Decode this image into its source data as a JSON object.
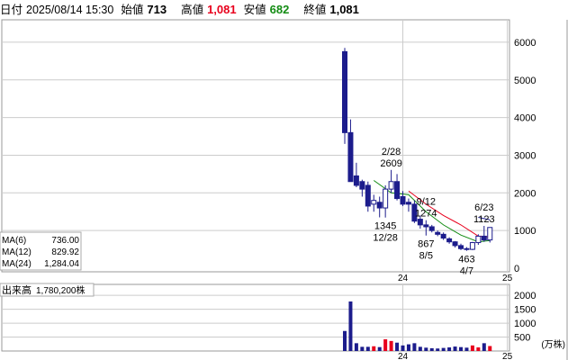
{
  "header": {
    "date_label": "日付",
    "date_value": "2025/08/14 15:30",
    "open_label": "始値",
    "open_value": "713",
    "high_label": "高値",
    "high_value": "1,081",
    "low_label": "安値",
    "low_value": "682",
    "close_label": "終値",
    "close_value": "1,081"
  },
  "legend": {
    "ma6_label": "MA(6)",
    "ma6_value": "736.00",
    "ma12_label": "MA(12)",
    "ma12_value": "829.92",
    "ma24_label": "MA(24)",
    "ma24_value": "1,284.04"
  },
  "volume": {
    "label": "出来高",
    "value": "1,780,200株",
    "unit": "(万株)"
  },
  "colors": {
    "candle_down": "#1c1c8c",
    "candle_up_border": "#1c1c8c",
    "ma6": "#138c13",
    "ma12": "#e8001c",
    "ma24": "#1c1c8c",
    "vol_up": "#e8001c",
    "vol_down": "#1c1c8c",
    "grid": "#cccccc"
  },
  "chart_data": {
    "type": "candlestick",
    "price_axis": {
      "ticks": [
        0,
        1000,
        2000,
        3000,
        4000,
        5000,
        6000
      ],
      "ylim": [
        0,
        6500
      ]
    },
    "volume_axis": {
      "ticks": [
        500,
        1000,
        1500,
        2000
      ],
      "ylim": [
        0,
        2200
      ]
    },
    "x_ticks": [
      {
        "label": "24",
        "index": 10
      },
      {
        "label": "25",
        "index": 28
      }
    ],
    "candles": [
      {
        "o": 5750,
        "h": 5850,
        "l": 3300,
        "c": 3600,
        "v": 720
      },
      {
        "o": 3600,
        "h": 3950,
        "l": 2300,
        "c": 2300,
        "v": 1780
      },
      {
        "o": 2450,
        "h": 2800,
        "l": 2150,
        "c": 2200,
        "v": 280
      },
      {
        "o": 2300,
        "h": 2350,
        "l": 1900,
        "c": 2100,
        "v": 150
      },
      {
        "o": 2200,
        "h": 2300,
        "l": 1500,
        "c": 1650,
        "v": 150
      },
      {
        "o": 1700,
        "h": 1950,
        "l": 1500,
        "c": 1800,
        "v": 170
      },
      {
        "o": 1750,
        "h": 1900,
        "l": 1350,
        "c": 1600,
        "v": 140
      },
      {
        "o": 1600,
        "h": 2200,
        "l": 1345,
        "c": 2100,
        "v": 420
      },
      {
        "o": 2100,
        "h": 2609,
        "l": 2000,
        "c": 2300,
        "v": 360
      },
      {
        "o": 2300,
        "h": 2500,
        "l": 1800,
        "c": 1850,
        "v": 300
      },
      {
        "o": 1900,
        "h": 2050,
        "l": 1650,
        "c": 1700,
        "v": 200
      },
      {
        "o": 1750,
        "h": 1850,
        "l": 1500,
        "c": 1700,
        "v": 240
      },
      {
        "o": 1700,
        "h": 1800,
        "l": 1200,
        "c": 1250,
        "v": 280
      },
      {
        "o": 1300,
        "h": 1400,
        "l": 1050,
        "c": 1150,
        "v": 150
      },
      {
        "o": 1150,
        "h": 1274,
        "l": 867,
        "c": 1100,
        "v": 120
      },
      {
        "o": 1100,
        "h": 1150,
        "l": 950,
        "c": 1000,
        "v": 100
      },
      {
        "o": 950,
        "h": 1000,
        "l": 850,
        "c": 900,
        "v": 90
      },
      {
        "o": 900,
        "h": 950,
        "l": 750,
        "c": 800,
        "v": 110
      },
      {
        "o": 780,
        "h": 820,
        "l": 650,
        "c": 700,
        "v": 130
      },
      {
        "o": 700,
        "h": 720,
        "l": 550,
        "c": 600,
        "v": 160
      },
      {
        "o": 600,
        "h": 650,
        "l": 480,
        "c": 520,
        "v": 140
      },
      {
        "o": 520,
        "h": 560,
        "l": 463,
        "c": 500,
        "v": 120
      },
      {
        "o": 500,
        "h": 700,
        "l": 480,
        "c": 680,
        "v": 200
      },
      {
        "o": 680,
        "h": 900,
        "l": 620,
        "c": 850,
        "v": 130
      },
      {
        "o": 850,
        "h": 1123,
        "l": 700,
        "c": 750,
        "v": 280
      },
      {
        "o": 750,
        "h": 1081,
        "l": 682,
        "c": 1081,
        "v": 178
      }
    ],
    "ma6": [
      [
        5,
        2330
      ],
      [
        8,
        2000
      ],
      [
        11,
        1950
      ],
      [
        14,
        1500
      ],
      [
        17,
        1150
      ],
      [
        20,
        880
      ],
      [
        23,
        700
      ],
      [
        25,
        736
      ]
    ],
    "ma12": [
      [
        11,
        2050
      ],
      [
        14,
        1700
      ],
      [
        17,
        1400
      ],
      [
        20,
        1150
      ],
      [
        23,
        850
      ],
      [
        25,
        830
      ]
    ],
    "ma24": [
      [
        23,
        1350
      ],
      [
        25,
        1284
      ]
    ],
    "annotations": [
      {
        "date": "2/28",
        "value": "2609",
        "index": 8,
        "pos": "above"
      },
      {
        "date": "12/28",
        "value": "1345",
        "index": 7,
        "pos": "below"
      },
      {
        "date": "9/12",
        "value": "1274",
        "index": 14,
        "pos": "above"
      },
      {
        "date": "8/5",
        "value": "867",
        "index": 14,
        "pos": "below"
      },
      {
        "date": "6/23",
        "value": "1123",
        "index": 24,
        "pos": "above"
      },
      {
        "date": "4/7",
        "value": "463",
        "index": 21,
        "pos": "below"
      }
    ]
  }
}
